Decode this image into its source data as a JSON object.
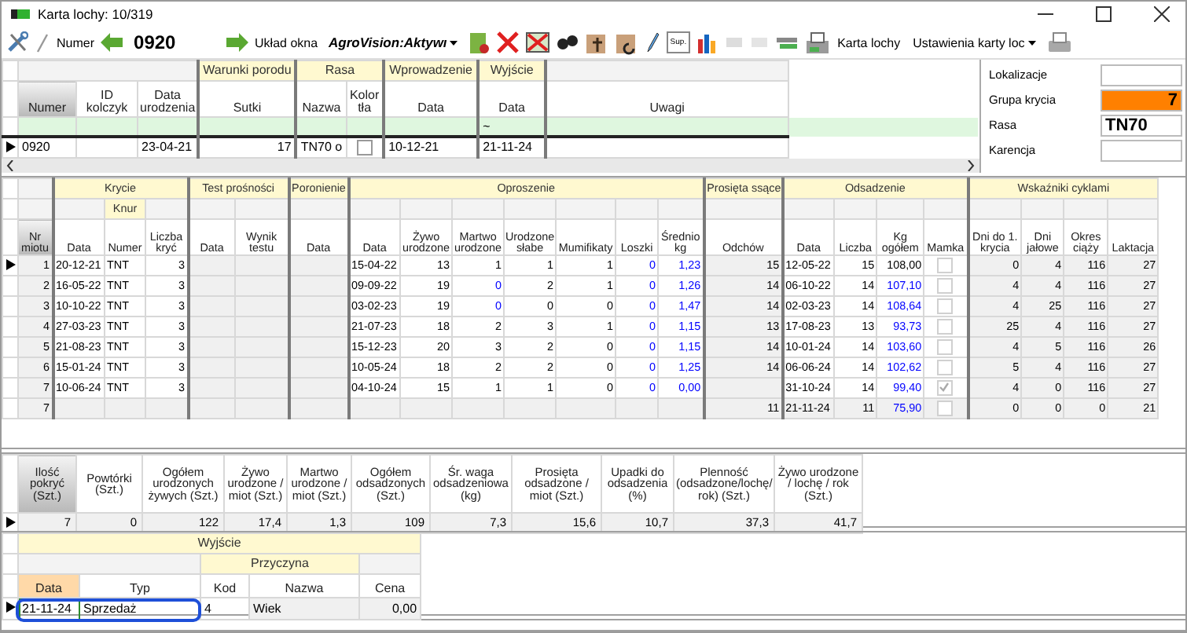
{
  "window": {
    "title": "Karta lochy: 10/319"
  },
  "toolbar": {
    "number_label": "Numer",
    "number": "0920",
    "layout_label": "Układ okna",
    "layout_value": "AgroVision:Aktywı",
    "sup_label": "Sup.",
    "card_button": "Karta lochy",
    "settings_value": "Ustawienia karty loc"
  },
  "sow_grid": {
    "groups": [
      {
        "columns": [
          {
            "label": "Numer",
            "kind": "text",
            "selected": true
          },
          {
            "label": "ID kolczyk",
            "kind": "text",
            "selected": false
          },
          {
            "label": "Data urodzenia",
            "kind": "text",
            "selected": false
          }
        ]
      },
      {
        "label": "Warunki porodu",
        "columns": [
          {
            "label": "Sutki",
            "kind": "number",
            "selected": false
          }
        ]
      },
      {
        "label": "Rasa",
        "columns": [
          {
            "label": "Nazwa",
            "kind": "text",
            "selected": false
          },
          {
            "label": "Kolor tła",
            "kind": "text",
            "selected": false
          }
        ]
      },
      {
        "label": "Wprowadzenie",
        "columns": [
          {
            "label": "Data",
            "kind": "text",
            "selected": false
          }
        ]
      },
      {
        "label": "Wyjście",
        "columns": [
          {
            "label": "Data",
            "kind": "text",
            "selected": false,
            "filter": "~"
          }
        ]
      },
      {
        "columns": [
          {
            "label": "Uwagi",
            "kind": "text",
            "selected": false
          }
        ]
      }
    ],
    "rows": [
      {
        "selected": true,
        "cells": [
          "0920",
          {},
          "23-04-21",
          "17",
          "TN70 o",
          {
            "kind": "check",
            "checked": false
          },
          "10-12-21",
          "21-11-24",
          {}
        ]
      }
    ]
  },
  "details": [
    {
      "label": "Lokalizacje"
    },
    {
      "label": "Grupa krycia",
      "value": "7",
      "color": "#ff8000"
    },
    {
      "label": "Rasa",
      "value": "TN70"
    },
    {
      "label": "Karencja"
    }
  ],
  "litters": {
    "groups": [
      {
        "columns": [
          {
            "label": "Nr miotu",
            "kind": "number",
            "shaded": true,
            "selected": true
          }
        ]
      },
      {
        "label": "Krycie",
        "columns": [
          {
            "label": "Data",
            "kind": "text",
            "shaded": false,
            "selected": false
          },
          {
            "label": "Numer",
            "sublabel": "Knur",
            "kind": "text",
            "shaded": false,
            "selected": false
          },
          {
            "label": "Liczba kryć",
            "kind": "number",
            "shaded": false,
            "selected": false
          }
        ]
      },
      {
        "label": "Test prośności",
        "columns": [
          {
            "label": "Data",
            "kind": "text",
            "shaded": true,
            "selected": false
          },
          {
            "label": "Wynik testu",
            "kind": "text",
            "shaded": true,
            "selected": false
          }
        ]
      },
      {
        "label": "Poronienie",
        "columns": [
          {
            "label": "Data",
            "kind": "text",
            "shaded": true,
            "selected": false
          }
        ]
      },
      {
        "label": "Oproszenie",
        "columns": [
          {
            "label": "Data",
            "kind": "text",
            "shaded": false,
            "selected": false
          },
          {
            "label": "Żywo urodzone",
            "kind": "number",
            "shaded": false,
            "selected": false
          },
          {
            "label": "Martwo urodzone",
            "kind": "number",
            "shaded": false,
            "selected": false
          },
          {
            "label": "Urodzone słabe",
            "kind": "number",
            "shaded": false,
            "selected": false
          },
          {
            "label": "Mumifikaty",
            "kind": "number",
            "shaded": false,
            "selected": false
          },
          {
            "label": "Loszki",
            "kind": "number",
            "shaded": false,
            "selected": false
          },
          {
            "label": "Średnio kg",
            "kind": "number",
            "shaded": false,
            "selected": false
          }
        ]
      },
      {
        "label": "Prosięta ssące",
        "columns": [
          {
            "label": "Odchów",
            "kind": "number",
            "shaded": true,
            "selected": false
          }
        ]
      },
      {
        "label": "Odsadzenie",
        "columns": [
          {
            "label": "Data",
            "kind": "text",
            "shaded": false,
            "selected": false
          },
          {
            "label": "Liczba",
            "kind": "number",
            "shaded": false,
            "selected": false
          },
          {
            "label": "Kg ogółem",
            "kind": "number",
            "shaded": false,
            "selected": false
          },
          {
            "label": "Mamka",
            "kind": "check",
            "shaded": false,
            "selected": false
          }
        ]
      },
      {
        "label": "Wskaźniki cyklami",
        "columns": [
          {
            "label": "Dni do 1. krycia",
            "kind": "number",
            "shaded": true,
            "selected": false
          },
          {
            "label": "Dni jałowe",
            "kind": "number",
            "shaded": true,
            "selected": false
          },
          {
            "label": "Okres ciąży",
            "kind": "number",
            "shaded": true,
            "selected": false
          },
          {
            "label": "Laktacja",
            "kind": "number",
            "shaded": true,
            "selected": false
          }
        ]
      }
    ],
    "rows": [
      {
        "selected": true,
        "shaded": false,
        "cells": [
          "1",
          "20-12-21",
          "TNT",
          "3",
          {},
          {},
          {},
          "15-04-22",
          "13",
          "1",
          "1",
          "1",
          {
            "text": "0",
            "color": "#0000ff"
          },
          {
            "text": "1,23",
            "color": "#0000ff"
          },
          "15",
          "12-05-22",
          "15",
          "108,00",
          {
            "kind": "check",
            "checked": false
          },
          "0",
          "4",
          "116",
          "27"
        ]
      },
      {
        "selected": false,
        "shaded": false,
        "cells": [
          "2",
          "16-05-22",
          "TNT",
          "3",
          {},
          {},
          {},
          "09-09-22",
          "19",
          {
            "text": "0",
            "color": "#0000ff"
          },
          "2",
          "1",
          {
            "text": "0",
            "color": "#0000ff"
          },
          {
            "text": "1,26",
            "color": "#0000ff"
          },
          "14",
          "06-10-22",
          "14",
          {
            "text": "107,10",
            "color": "#0000ff"
          },
          {
            "kind": "check",
            "checked": false
          },
          "4",
          "4",
          "116",
          "27"
        ]
      },
      {
        "selected": false,
        "shaded": false,
        "cells": [
          "3",
          "10-10-22",
          "TNT",
          "3",
          {},
          {},
          {},
          "03-02-23",
          "19",
          {
            "text": "0",
            "color": "#0000ff"
          },
          "0",
          "0",
          {
            "text": "0",
            "color": "#0000ff"
          },
          {
            "text": "1,47",
            "color": "#0000ff"
          },
          "14",
          "02-03-23",
          "14",
          {
            "text": "108,64",
            "color": "#0000ff"
          },
          {
            "kind": "check",
            "checked": false
          },
          "4",
          "25",
          "116",
          "27"
        ]
      },
      {
        "selected": false,
        "shaded": false,
        "cells": [
          "4",
          "27-03-23",
          "TNT",
          "3",
          {},
          {},
          {},
          "21-07-23",
          "18",
          "2",
          "3",
          "1",
          {
            "text": "0",
            "color": "#0000ff"
          },
          {
            "text": "1,15",
            "color": "#0000ff"
          },
          "13",
          "17-08-23",
          "13",
          {
            "text": "93,73",
            "color": "#0000ff"
          },
          {
            "kind": "check",
            "checked": false
          },
          "25",
          "4",
          "116",
          "27"
        ]
      },
      {
        "selected": false,
        "shaded": false,
        "cells": [
          "5",
          "21-08-23",
          "TNT",
          "3",
          {},
          {},
          {},
          "15-12-23",
          "20",
          "3",
          "2",
          "0",
          {
            "text": "0",
            "color": "#0000ff"
          },
          {
            "text": "1,15",
            "color": "#0000ff"
          },
          "14",
          "10-01-24",
          "14",
          {
            "text": "103,60",
            "color": "#0000ff"
          },
          {
            "kind": "check",
            "checked": false
          },
          "4",
          "5",
          "116",
          "26"
        ]
      },
      {
        "selected": false,
        "shaded": false,
        "cells": [
          "6",
          "15-01-24",
          "TNT",
          "3",
          {},
          {},
          {},
          "10-05-24",
          "18",
          "2",
          "2",
          "0",
          {
            "text": "0",
            "color": "#0000ff"
          },
          {
            "text": "1,25",
            "color": "#0000ff"
          },
          "14",
          "06-06-24",
          "14",
          {
            "text": "102,62",
            "color": "#0000ff"
          },
          {
            "kind": "check",
            "checked": false
          },
          "5",
          "4",
          "116",
          "27"
        ]
      },
      {
        "selected": false,
        "shaded": false,
        "cells": [
          "7",
          "10-06-24",
          "TNT",
          "3",
          {},
          {},
          {},
          "04-10-24",
          "15",
          "1",
          "1",
          "0",
          {
            "text": "0",
            "color": "#0000ff"
          },
          {
            "text": "0,00",
            "color": "#0000ff"
          },
          {},
          "31-10-24",
          "14",
          {
            "text": "99,40",
            "color": "#0000ff"
          },
          {
            "kind": "check",
            "checked": true
          },
          "4",
          "0",
          "116",
          "27"
        ]
      },
      {
        "selected": false,
        "shaded": true,
        "cells": [
          "7",
          {},
          {},
          {},
          {},
          {},
          {},
          {},
          {},
          {},
          {},
          {},
          {},
          {},
          "11",
          "21-11-24",
          "11",
          {
            "text": "75,90",
            "color": "#0000ff"
          },
          {
            "kind": "check",
            "checked": false
          },
          "0",
          "0",
          "0",
          "21"
        ]
      }
    ]
  },
  "summary": {
    "selected": true,
    "columns": [
      {
        "label": "Ilość pokryć (Szt.)",
        "value": "7",
        "selected": true
      },
      {
        "label": "Powtórki (Szt.)",
        "value": "0",
        "selected": false
      },
      {
        "label": "Ogółem urodzonych żywych (Szt.)",
        "value": "122",
        "selected": false
      },
      {
        "label": "Żywo urodzone / miot (Szt.)",
        "value": "17,4",
        "selected": false
      },
      {
        "label": "Martwo urodzone / miot (Szt.)",
        "value": "1,3",
        "selected": false
      },
      {
        "label": "Ogółem odsadzonych (Szt.)",
        "value": "109",
        "selected": false
      },
      {
        "label": "Śr. waga odsadzeniowa (kg)",
        "value": "7,3",
        "selected": false
      },
      {
        "label": "Prosięta odsadzone / miot (Szt.)",
        "value": "15,6",
        "selected": false
      },
      {
        "label": "Upadki do odsadzenia (%)",
        "value": "10,7",
        "selected": false
      },
      {
        "label": "Plenność (odsadzone/lochę/ rok) (Szt.)",
        "value": "37,3",
        "selected": false
      },
      {
        "label": "Żywo urodzone / lochę / rok (Szt.)",
        "value": "41,7",
        "selected": false
      }
    ]
  },
  "exit": {
    "title": "Wyjście",
    "groups": [
      {
        "columns": [
          {
            "label": "Data",
            "kind": "text",
            "selected": true
          },
          {
            "label": "Typ",
            "kind": "text",
            "selected": false
          }
        ]
      },
      {
        "label": "Przyczyna",
        "columns": [
          {
            "label": "Kod",
            "kind": "text",
            "selected": false
          },
          {
            "label": "Nazwa",
            "kind": "text",
            "selected": false
          }
        ]
      },
      {
        "columns": [
          {
            "label": "Cena",
            "kind": "number",
            "selected": false
          }
        ]
      }
    ],
    "rows": [
      {
        "selected": true,
        "highlighted": true,
        "cells": [
          "21-11-24",
          "Sprzedaż",
          "4",
          "Wiek",
          "0,00"
        ]
      }
    ]
  }
}
